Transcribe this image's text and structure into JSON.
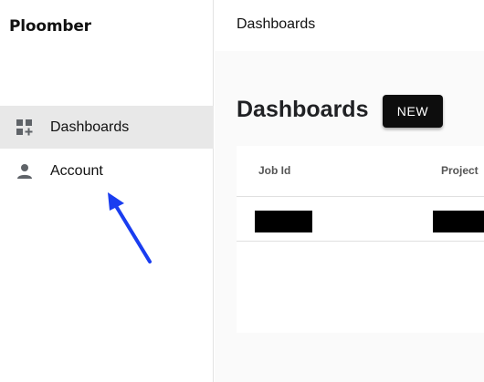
{
  "brand": {
    "name": "Ploomber"
  },
  "sidebar": {
    "items": [
      {
        "label": "Dashboards",
        "icon": "dashboard-add-icon",
        "active": true
      },
      {
        "label": "Account",
        "icon": "person-icon",
        "active": false
      }
    ]
  },
  "topbar": {
    "title": "Dashboards"
  },
  "main": {
    "title": "Dashboards",
    "new_button_label": "NEW",
    "table": {
      "columns": [
        "Job Id",
        "Project"
      ],
      "rows": [
        {
          "job_id": "[redacted]",
          "project": "[redacted]"
        }
      ]
    }
  },
  "colors": {
    "active_nav_bg": "#e8e8e8",
    "button_bg": "#0d0d0d",
    "annotation_arrow": "#1a3df0"
  }
}
